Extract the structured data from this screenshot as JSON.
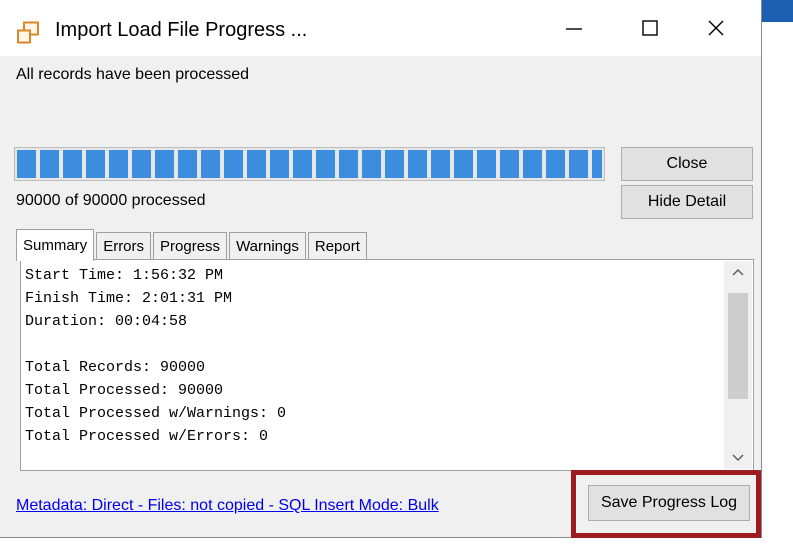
{
  "window": {
    "title": "Import Load File Progress ...",
    "status_message": "All records have been processed"
  },
  "window_controls": {
    "minimize_icon": "minimize-icon",
    "maximize_icon": "maximize-icon",
    "close_icon": "close-icon"
  },
  "progress": {
    "fraction": 1.0,
    "processed_text": "90000 of 90000 processed",
    "fill_color": "#3c8dde"
  },
  "buttons": {
    "close_label": "Close",
    "hide_detail_label": "Hide Detail",
    "save_log_label": "Save Progress Log"
  },
  "tabs": [
    {
      "label": "Summary",
      "active": true
    },
    {
      "label": "Errors",
      "active": false
    },
    {
      "label": "Progress",
      "active": false
    },
    {
      "label": "Warnings",
      "active": false
    },
    {
      "label": "Report",
      "active": false
    }
  ],
  "summary_log": [
    "Start Time: 1:56:32 PM",
    "Finish Time: 2:01:31 PM",
    "Duration: 00:04:58",
    "",
    "Total Records: 90000",
    "Total Processed: 90000",
    "Total Processed w/Warnings: 0",
    "Total Processed w/Errors: 0"
  ],
  "footer": {
    "metadata_link": "Metadata: Direct - Files: not copied - SQL Insert Mode: Bulk"
  },
  "colors": {
    "highlight": "#9d1c22",
    "link": "#0000ee",
    "desktop_accent": "#1d5fb1"
  }
}
